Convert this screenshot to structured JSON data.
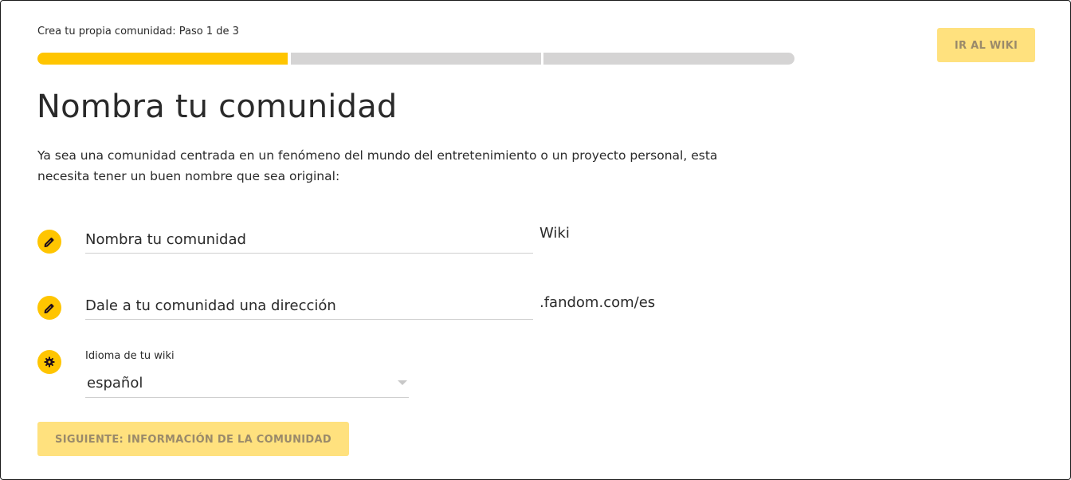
{
  "header": {
    "step_label": "Crea tu propia comunidad: Paso 1 de 3",
    "go_to_wiki_label": "IR AL WIKI",
    "progress": {
      "current_step": 1,
      "total_steps": 3
    }
  },
  "main": {
    "title": "Nombra tu comunidad",
    "description": "Ya sea una comunidad centrada en un fenómeno del mundo del entretenimiento o un proyecto personal, esta necesita tener un buen nombre que sea original:"
  },
  "form": {
    "name_field": {
      "placeholder": "Nombra tu comunidad",
      "value": "",
      "suffix": "Wiki",
      "icon": "pencil-icon"
    },
    "address_field": {
      "placeholder": "Dale a tu comunidad una dirección",
      "value": "",
      "suffix": ".fandom.com/es",
      "icon": "pencil-icon"
    },
    "language": {
      "label": "Idioma de tu wiki",
      "value": "español",
      "icon": "gear-icon"
    },
    "next_button_label": "SIGUIENTE: INFORMACIÓN DE LA COMUNIDAD"
  },
  "colors": {
    "accent": "#ffc500",
    "button_disabled": "#ffe17e",
    "progress_inactive": "#d5d4d4"
  }
}
